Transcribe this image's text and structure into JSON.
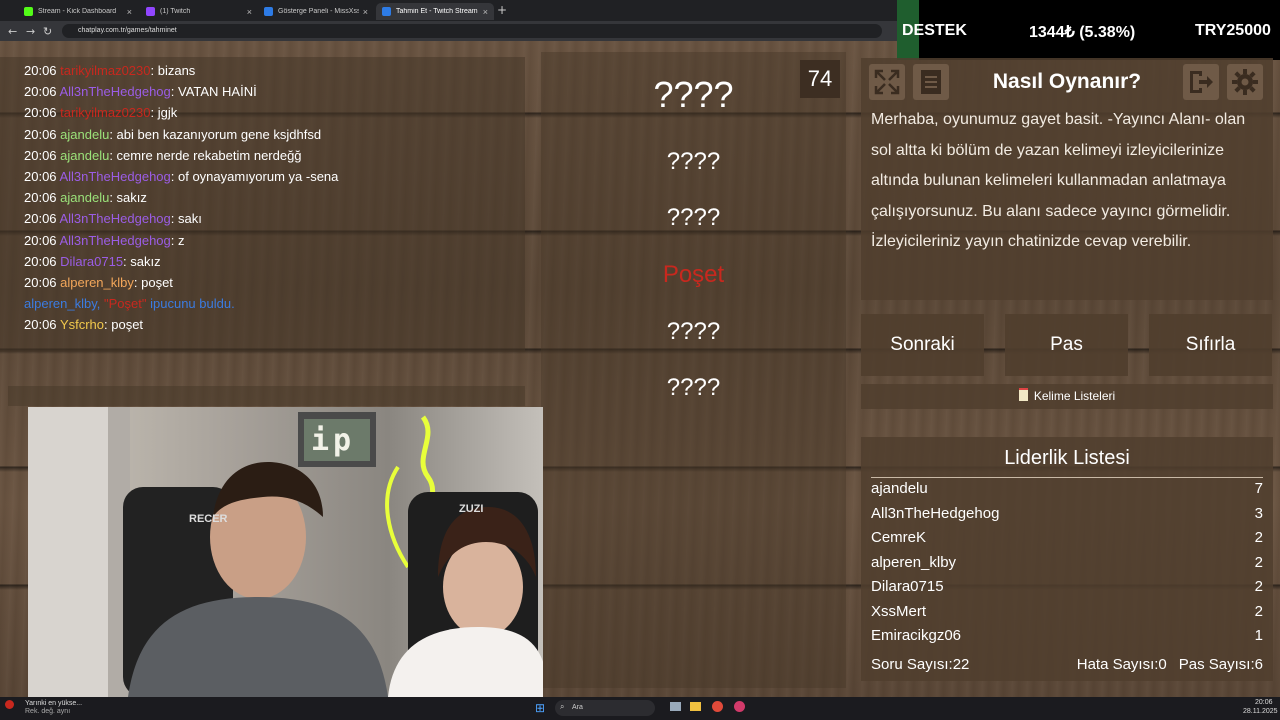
{
  "browser": {
    "tabs": [
      {
        "title": "Stream - Kick Dashboard",
        "color": "#53fc18"
      },
      {
        "title": "(1) Twitch",
        "color": "#9146ff"
      },
      {
        "title": "Gösterge Paneli - MissXss AI Bot",
        "color": "#2d7be5"
      },
      {
        "title": "Tahmin Et - Twitch Stream Games",
        "color": "#2d7be5"
      }
    ],
    "url": "chatplay.com.tr/games/tahminet"
  },
  "ticker": {
    "label": "DESTEK",
    "price": "1344₺ (5.38%)",
    "goal": "TRY25000"
  },
  "chat": [
    {
      "time": "20:06",
      "user": "tarikyilmaz0230",
      "user_color": "#c8281e",
      "msg": ": bizans"
    },
    {
      "time": "20:06",
      "user": "All3nTheHedgehog",
      "user_color": "#9b5de5",
      "msg": ": VATAN HAİNİ"
    },
    {
      "time": "20:06",
      "user": "tarikyilmaz0230",
      "user_color": "#c8281e",
      "msg": ": jgjk"
    },
    {
      "time": "20:06",
      "user": "ajandelu",
      "user_color": "#9be27a",
      "msg": ": abi ben kazanıyorum gene ksjdhfsd"
    },
    {
      "time": "20:06",
      "user": "ajandelu",
      "user_color": "#9be27a",
      "msg": ": cemre nerde rekabetim nerdeğğ"
    },
    {
      "time": "20:06",
      "user": "All3nTheHedgehog",
      "user_color": "#9b5de5",
      "msg": ": of oynayamıyorum ya -sena"
    },
    {
      "time": "20:06",
      "user": "ajandelu",
      "user_color": "#9be27a",
      "msg": ": sakız"
    },
    {
      "time": "20:06",
      "user": "All3nTheHedgehog",
      "user_color": "#9b5de5",
      "msg": ": sakı"
    },
    {
      "time": "20:06",
      "user": "All3nTheHedgehog",
      "user_color": "#9b5de5",
      "msg": ": z"
    },
    {
      "time": "20:06",
      "user": "Dilara0715",
      "user_color": "#9b5de5",
      "msg": ": sakız"
    },
    {
      "time": "20:06",
      "user": "alperen_klby",
      "user_color": "#f2a65a",
      "msg": ": poşet"
    },
    {
      "time": "",
      "user": "alperen_klby,",
      "user_color": "#3b7be0",
      "msg": "",
      "hint_word": "\"Poşet\"",
      "hint_suffix": "ipucunu buldu."
    },
    {
      "time": "20:06",
      "user": "Ysfcrho",
      "user_color": "#f2c94c",
      "msg": ": poşet"
    }
  ],
  "game": {
    "counter": "74",
    "words": [
      "????",
      "????",
      "????",
      "Poşet",
      "????",
      "????"
    ]
  },
  "how_to_play": {
    "title": "Nasıl Oynanır?",
    "text": "Merhaba, oyunumuz gayet basit. -Yayıncı Alanı- olan sol altta ki bölüm de yazan kelimeyi izleyicilerinize altında bulunan kelimeleri kullanmadan anlatmaya çalışıyorsunuz. Bu alanı sadece yayıncı görmelidir. İzleyicileriniz yayın chatinizde cevap verebilir."
  },
  "buttons": {
    "next": "Sonraki",
    "pass": "Pas",
    "reset": "Sıfırla",
    "word_lists": "Kelime Listeleri"
  },
  "leaderboard": {
    "title": "Liderlik Listesi",
    "rows": [
      {
        "name": "ajandelu",
        "score": "7"
      },
      {
        "name": "All3nTheHedgehog",
        "score": "3"
      },
      {
        "name": "CemreK",
        "score": "2"
      },
      {
        "name": "alperen_klby",
        "score": "2"
      },
      {
        "name": "Dilara0715",
        "score": "2"
      },
      {
        "name": "XssMert",
        "score": "2"
      },
      {
        "name": "Emiracikgz06",
        "score": "1"
      }
    ],
    "question_count": "Soru Sayısı:22",
    "mistake_count": "Hata Sayısı:0",
    "pass_count": "Pas Sayısı:6"
  },
  "webcam": {
    "sign_text": "ip",
    "chair_left": "RECER",
    "chair_right": "ZUZI"
  },
  "taskbar": {
    "notif_title": "Yarınki en yükse...",
    "notif_sub": "Rek. değ. aynı",
    "search": "Ara",
    "time": "20:06",
    "date": "28.11.2025"
  }
}
